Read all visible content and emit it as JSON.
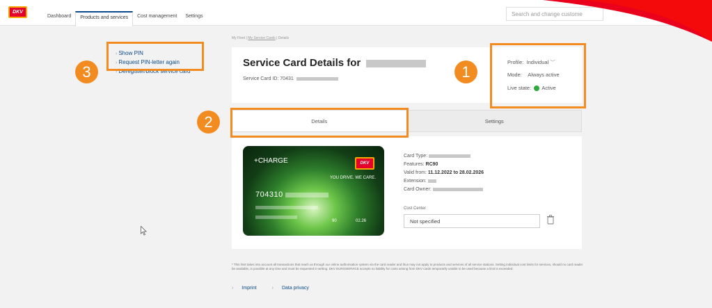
{
  "nav": {
    "tabs": [
      {
        "label": "Dashboard"
      },
      {
        "label": "Products and services"
      },
      {
        "label": "Cost management"
      },
      {
        "label": "Settings"
      }
    ],
    "logo_text": "DKV",
    "search_placeholder": "Search and change custome"
  },
  "breadcrumb": {
    "home": "My Fleet",
    "sep1": "|",
    "cards": "My Service Cards",
    "sep2": "|",
    "current": "Details"
  },
  "side_actions": [
    {
      "label": "Show PIN"
    },
    {
      "label": "Request PIN-letter again"
    },
    {
      "label": "Deregister/block service card"
    }
  ],
  "header": {
    "title": "Service Card Details for",
    "card_id_label": "Service Card ID: 70431"
  },
  "status": {
    "profile_label": "Profile:",
    "profile_value": "Individual",
    "mode_label": "Mode:",
    "mode_value": "Always active",
    "live_label": "Live state:",
    "live_value": "Active",
    "live_color": "#2eaa3a"
  },
  "tabs": [
    {
      "label": "Details",
      "active": true
    },
    {
      "label": "Settings",
      "active": false
    }
  ],
  "card_visual": {
    "brand": "+CHARGE",
    "logo": "DKV",
    "slogan": "YOU DRIVE. WE CARE.",
    "pan_prefix": "704310",
    "code": "90",
    "expiry": "02.26"
  },
  "details": {
    "type_label": "Card Type:",
    "features_label": "Features:",
    "features_value": "RC90",
    "valid_label": "Valid from:",
    "valid_value": "11.12.2022 to 28.02.2026",
    "extension_label": "Extension:",
    "owner_label": "Card Owner:"
  },
  "cost_center": {
    "label": "Cost Center",
    "value": "Not specified"
  },
  "disclaimer": "* This limit takes into account all transactions that reach us through our online authorisation system via the card reader and thus may not apply to products and services of all service stations. Setting individual cost limits for services, should no card reader be available, is possible at any time and must be requested in writing. DKV EUROSERVICE accepts no liability for costs arising from DKV cards temporarily unable to be used because a limit is exceeded.",
  "footer": {
    "imprint": "Imprint",
    "privacy": "Data privacy"
  },
  "annotations": [
    "1",
    "2",
    "3"
  ],
  "colors": {
    "accent": "#f28b20",
    "brand_red": "#e4002b",
    "link": "#0a4a8a"
  }
}
